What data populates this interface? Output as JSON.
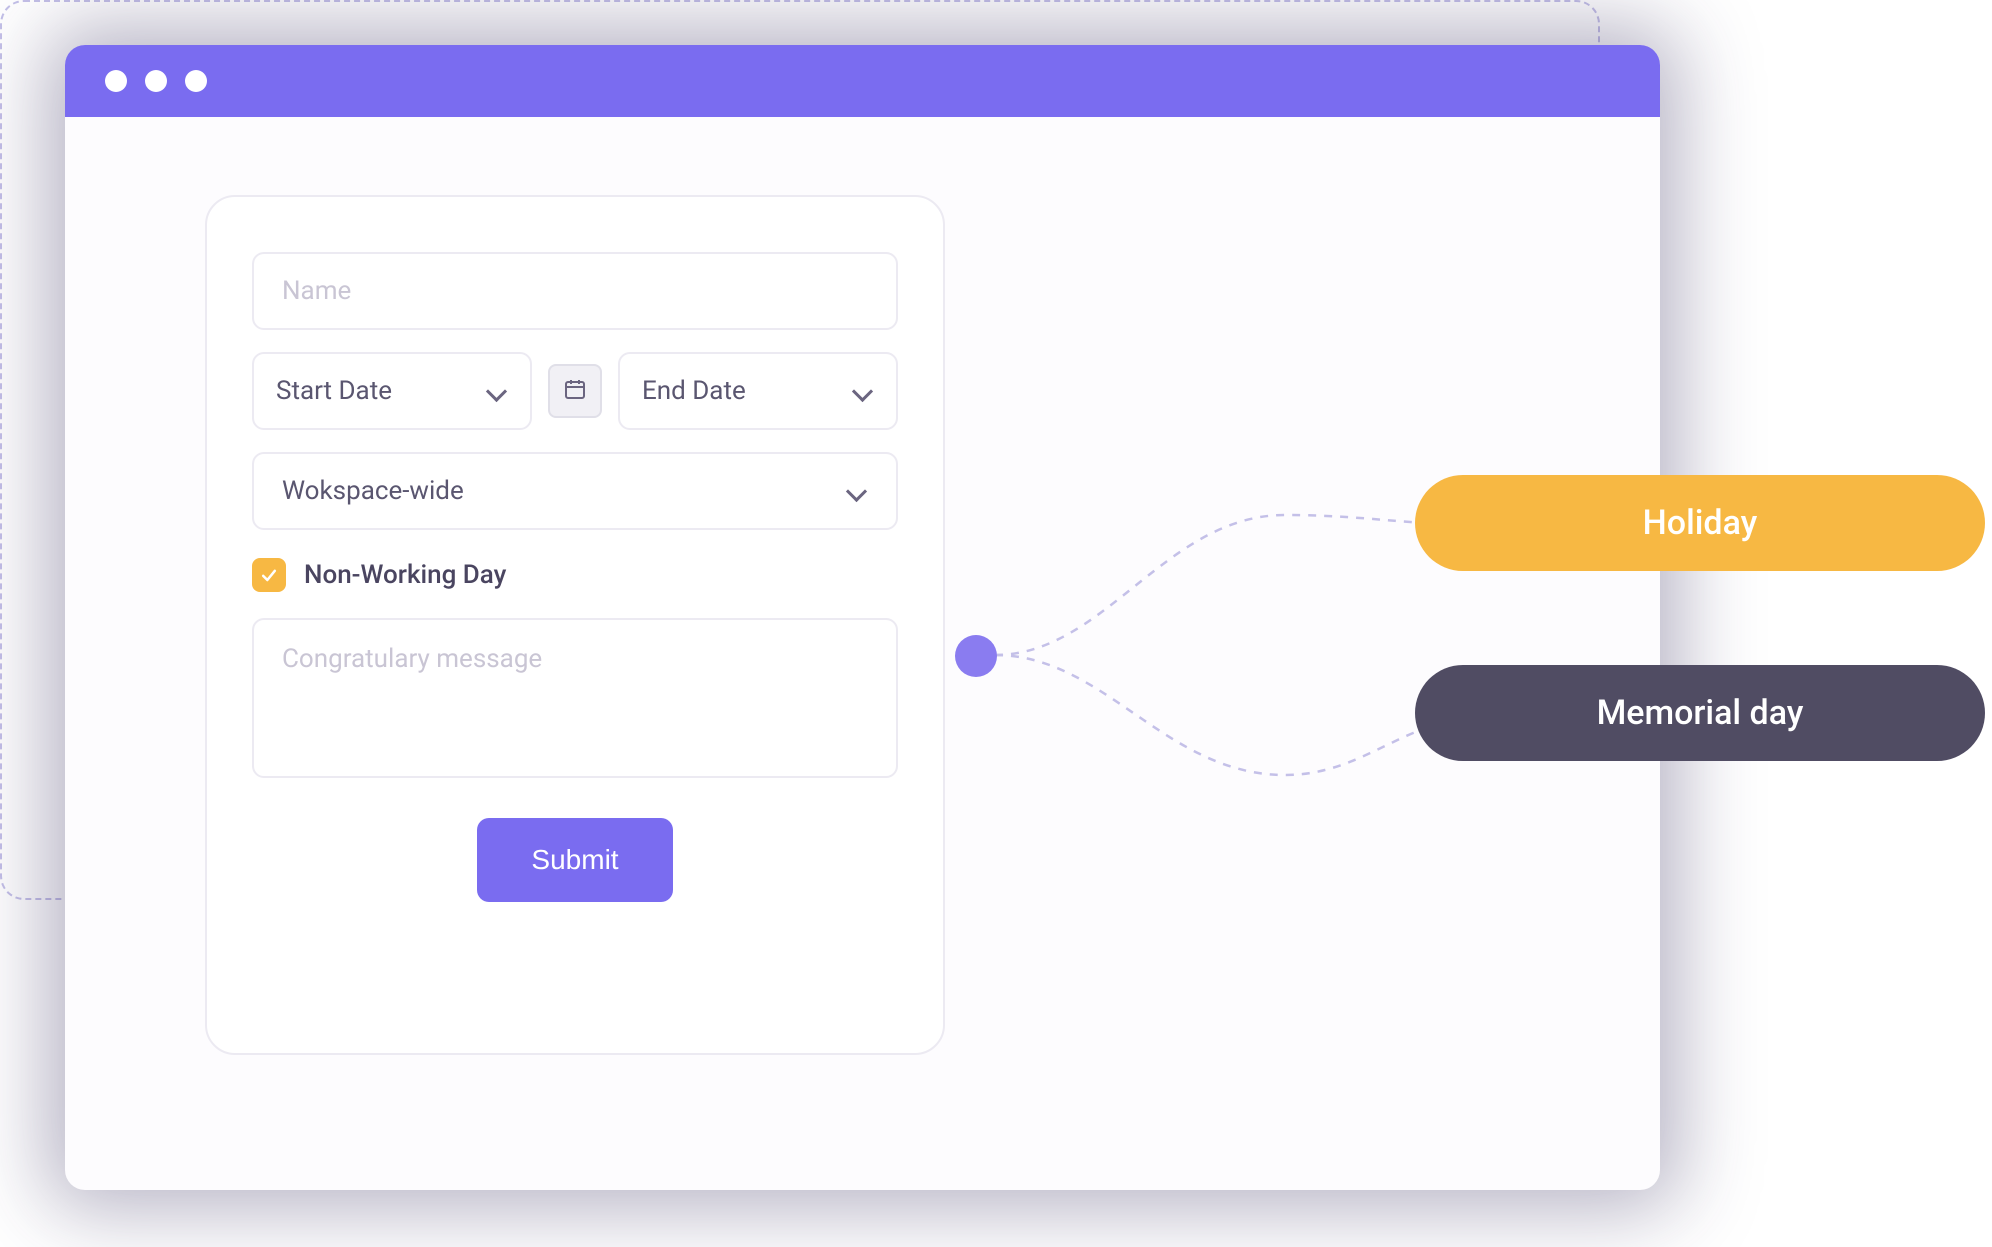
{
  "form": {
    "name_placeholder": "Name",
    "start_date_placeholder": "Start Date",
    "end_date_placeholder": "End Date",
    "workspace_placeholder": "Wokspace-wide",
    "checkbox_label": "Non-Working Day",
    "checkbox_checked": true,
    "message_placeholder": "Congratulary message",
    "submit_label": "Submit"
  },
  "tags": {
    "holiday": "Holiday",
    "memorial": "Memorial day"
  },
  "colors": {
    "primary": "#7a6cf0",
    "accent": "#f7b843",
    "dark": "#504c63"
  }
}
